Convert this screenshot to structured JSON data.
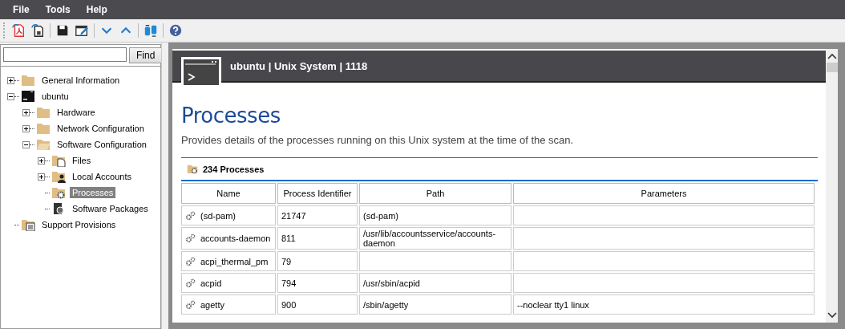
{
  "menu": [
    "File",
    "Tools",
    "Help"
  ],
  "search": {
    "button": "Find"
  },
  "tree": [
    {
      "label": "General Information",
      "kind": "folder",
      "expanded": false,
      "selected": false
    },
    {
      "label": "ubuntu",
      "kind": "terminal",
      "expanded": true,
      "selected": false,
      "children": [
        {
          "label": "Hardware",
          "kind": "folder",
          "expanded": false,
          "selected": false
        },
        {
          "label": "Network Configuration",
          "kind": "folder",
          "expanded": false,
          "selected": false
        },
        {
          "label": "Software Configuration",
          "kind": "folder-open",
          "expanded": true,
          "selected": false,
          "children": [
            {
              "label": "Files",
              "kind": "folder-doc",
              "expanded": false,
              "selected": false
            },
            {
              "label": "Local Accounts",
              "kind": "folder-user",
              "expanded": false,
              "selected": false
            },
            {
              "label": "Processes",
              "kind": "folder-gear",
              "selected": true
            },
            {
              "label": "Software Packages",
              "kind": "package",
              "selected": false
            }
          ]
        }
      ]
    },
    {
      "label": "Support Provisions",
      "kind": "folder-list",
      "selected": false
    }
  ],
  "header": {
    "title": "ubuntu | Unix System | 1118"
  },
  "page": {
    "title": "Processes",
    "description": "Provides details of the processes running on this Unix system at the time of the scan."
  },
  "section": {
    "title": "234 Processes"
  },
  "table": {
    "columns": [
      "Name",
      "Process Identifier",
      "Path",
      "Parameters"
    ],
    "rows": [
      [
        "(sd-pam)",
        "21747",
        "(sd-pam)",
        ""
      ],
      [
        "accounts-daemon",
        "811",
        "/usr/lib/accountsservice/accounts-daemon",
        ""
      ],
      [
        "acpi_thermal_pm",
        "79",
        "",
        ""
      ],
      [
        "acpid",
        "794",
        "/usr/sbin/acpid",
        ""
      ],
      [
        "agetty",
        "900",
        "/sbin/agetty",
        "--noclear tty1 linux"
      ]
    ]
  }
}
